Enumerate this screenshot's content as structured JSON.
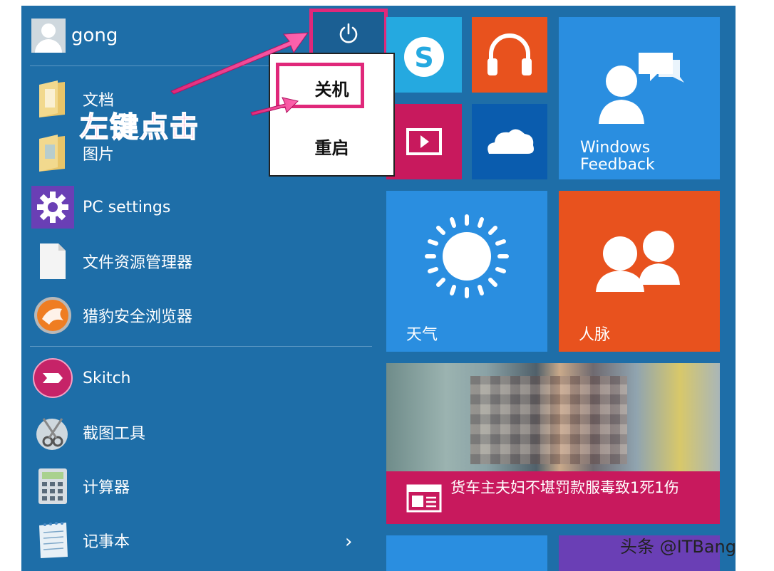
{
  "user": {
    "name": "gong"
  },
  "power_menu": {
    "items": [
      "关机",
      "重启"
    ]
  },
  "annotation": "左键点击",
  "apps": [
    {
      "label": "文档",
      "icon": "folder-icon"
    },
    {
      "label": "图片",
      "icon": "folder-icon"
    },
    {
      "label": "PC settings",
      "icon": "gear-icon"
    },
    {
      "label": "文件资源管理器",
      "icon": "document-icon"
    },
    {
      "label": "猎豹安全浏览器",
      "icon": "cheetah-browser-icon"
    },
    {
      "label": "Skitch",
      "icon": "skitch-icon"
    },
    {
      "label": "截图工具",
      "icon": "snipping-tool-icon"
    },
    {
      "label": "计算器",
      "icon": "calculator-icon"
    },
    {
      "label": "记事本",
      "icon": "notepad-icon"
    }
  ],
  "tiles": {
    "windows_feedback": "Windows\nFeedback",
    "weather": "天气",
    "people": "人脉",
    "news_headline": "货车主夫妇不堪罚款服毒致1死1伤"
  },
  "colors": {
    "start_bg": "#1e6ea8",
    "highlight": "#e0287a",
    "skype": "#25a9e0",
    "music": "#e8521e",
    "video": "#c8195d",
    "onedrive": "#0a5cae",
    "feedback": "#2a8ee0",
    "weather": "#2a8ee0",
    "people": "#e8521e"
  },
  "watermark": "头条 @ITBang"
}
